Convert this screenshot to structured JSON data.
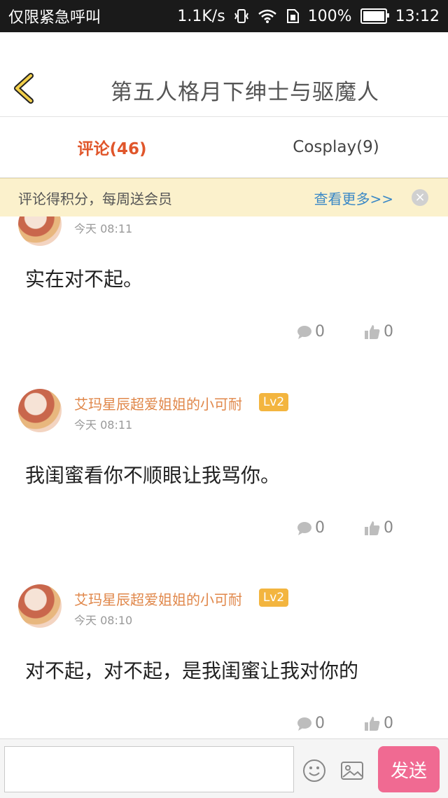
{
  "status_bar": {
    "carrier": "仅限紧急呼叫",
    "speed": "1.1K/s",
    "battery": "100%",
    "time": "13:12"
  },
  "header": {
    "title": "第五人格月下绅士与驱魔人"
  },
  "tabs": [
    {
      "label": "评论(46)"
    },
    {
      "label": "Cosplay(9)"
    }
  ],
  "banner": {
    "text": "评论得积分，每周送会员",
    "link": "查看更多>>",
    "close": "×"
  },
  "comments": [
    {
      "time": "今天 08:11",
      "text": "实在对不起。",
      "reply_count": "0",
      "like_count": "0"
    },
    {
      "username": "艾玛星辰超爱姐姐的小可耐",
      "level": "Lv2",
      "time": "今天 08:11",
      "text": "我闺蜜看你不顺眼让我骂你。",
      "reply_count": "0",
      "like_count": "0"
    },
    {
      "username": "艾玛星辰超爱姐姐的小可耐",
      "level": "Lv2",
      "time": "今天 08:10",
      "text": "对不起，对不起，是我闺蜜让我对你的",
      "reply_count": "0",
      "like_count": "0"
    }
  ],
  "input_bar": {
    "placeholder": "",
    "send_label": "发送"
  },
  "colors": {
    "accent": "#e0562b",
    "username": "#e0874a",
    "level_badge": "#f3b53f",
    "send_button": "#f06a92",
    "banner_bg": "#fbf1cc",
    "link": "#3a88c6"
  }
}
